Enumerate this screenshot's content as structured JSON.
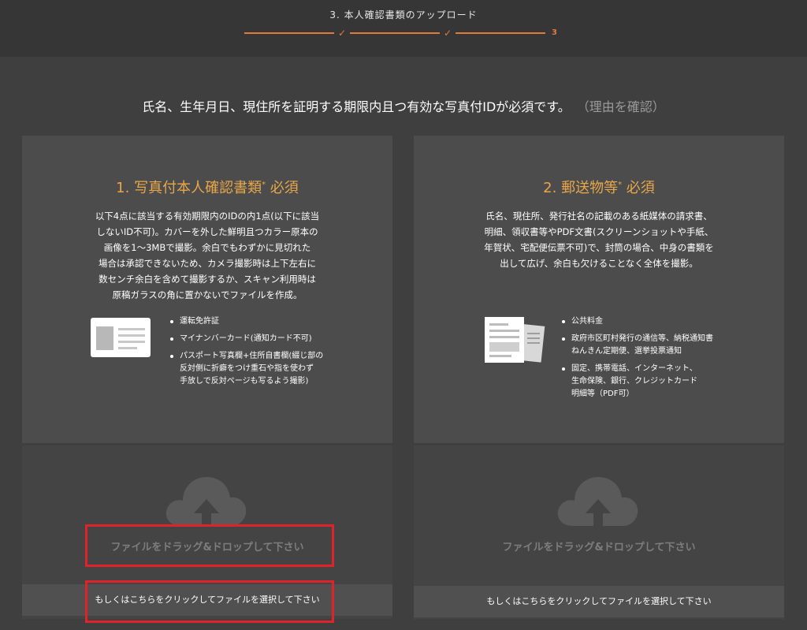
{
  "header": {
    "step_title": "3. 本人確認書類のアップロード",
    "progress": {
      "mark1": "✓",
      "mark2": "✓",
      "current_step": "3"
    }
  },
  "headline": {
    "text": "氏名、生年月日、現住所を証明する期限内且つ有効な写真付IDが必須です。",
    "reason_link": "（理由を確認）"
  },
  "cards": [
    {
      "title": "1. 写真付本人確認書類",
      "title_mark": "*",
      "title_suffix": " 必須",
      "description": [
        "以下4点に該当する有効期限内のIDの内1点(以下に該当",
        "しないID不可)。カバーを外した鮮明且つカラー原本の",
        "画像を1～3MBで撮影。余白でもわずかに見切れた",
        "場合は承認できないため、カメラ撮影時は上下左右に",
        "数センチ余白を含めて撮影するか、スキャン利用時は",
        "原稿ガラスの角に置かないでファイルを作成。"
      ],
      "icon": "id-card-icon",
      "bullets": [
        [
          "運転免許証"
        ],
        [
          "マイナンバーカード(通知カード不可)"
        ],
        [
          "パスポート写真欄+住所自書欄(綴じ部の",
          "反対側に折癖をつけ重石や指を使わず",
          "手放しで反対ページも写るよう撮影)"
        ]
      ]
    },
    {
      "title": "2. 郵送物等",
      "title_mark": "*",
      "title_suffix": " 必須",
      "description": [
        "氏名、現住所、発行社名の記載のある紙媒体の請求書、",
        "明細、領収書等やPDF文書(スクリーンショットや手紙、",
        "年賀状、宅配便伝票不可)で、封筒の場合、中身の書類を",
        "出して広げ、余白も欠けることなく全体を撮影。"
      ],
      "icon": "documents-icon",
      "bullets": [
        [
          "公共料金"
        ],
        [
          "政府市区町村発行の通信等、納税通知書",
          "ねんきん定期便、選挙投票通知"
        ],
        [
          "固定、携帯電話、インターネット、",
          "生命保険、銀行、クレジットカード",
          "明細等（PDF可）"
        ]
      ]
    }
  ],
  "upload": {
    "drop_text": "ファイルをドラッグ&ドロップして下さい",
    "click_text": "もしくはこちらをクリックしてファイルを選択して下さい",
    "icon": "cloud-upload-icon"
  },
  "colors": {
    "accent_orange": "#e07a3e",
    "title_gold": "#e8a74a",
    "highlight_red": "#e0222a",
    "background": "#3f3f3f"
  }
}
